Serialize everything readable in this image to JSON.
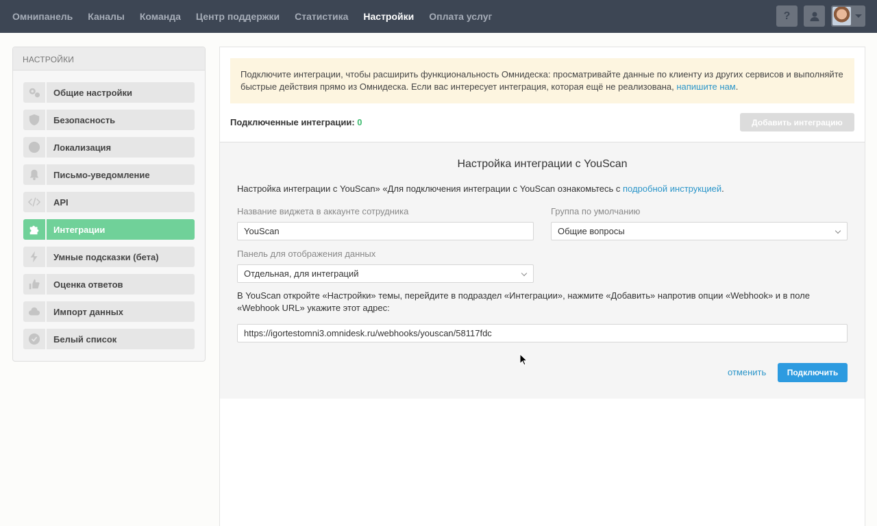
{
  "nav": {
    "items": [
      {
        "label": "Омнипанель"
      },
      {
        "label": "Каналы"
      },
      {
        "label": "Команда"
      },
      {
        "label": "Центр поддержки"
      },
      {
        "label": "Статистика"
      },
      {
        "label": "Настройки",
        "active": true
      },
      {
        "label": "Оплата услуг"
      }
    ],
    "help_label": "?"
  },
  "sidebar": {
    "title": "НАСТРОЙКИ",
    "items": [
      {
        "label": "Общие настройки",
        "icon": "gears-icon"
      },
      {
        "label": "Безопасность",
        "icon": "shield-icon"
      },
      {
        "label": "Локализация",
        "icon": "globe-icon"
      },
      {
        "label": "Письмо-уведомление",
        "icon": "bell-icon"
      },
      {
        "label": "API",
        "icon": "code-icon"
      },
      {
        "label": "Интеграции",
        "icon": "puzzle-icon",
        "active": true
      },
      {
        "label": "Умные подсказки (бета)",
        "icon": "lightning-icon"
      },
      {
        "label": "Оценка ответов",
        "icon": "thumbs-up-icon"
      },
      {
        "label": "Импорт данных",
        "icon": "cloud-upload-icon"
      },
      {
        "label": "Белый список",
        "icon": "check-badge-icon"
      }
    ]
  },
  "notice": {
    "text": "Подключите интеграции, чтобы расширить функциональность Омнидеска: просматривайте данные по клиенту из других сервисов и выполняйте быстрые действия прямо из Омнидеска. Если вас интересует интеграция, которая ещё не реализована, ",
    "link": "напишите нам",
    "tail": "."
  },
  "connected": {
    "label": "Подключенные интеграции:",
    "count": "0"
  },
  "add_button": "Добавить интеграцию",
  "form": {
    "title": "Настройка интеграции с YouScan",
    "desc_text": "Настройка интеграции с YouScan» «Для подключения интеграции с YouScan ознакомьтесь с ",
    "desc_link": "подробной инструкцией",
    "desc_tail": ".",
    "widget_name_label": "Название виджета в аккаунте сотрудника",
    "widget_name_value": "YouScan",
    "group_label": "Группа по умолчанию",
    "group_value": "Общие вопросы",
    "panel_label": "Панель для отображения данных",
    "panel_value": "Отдельная, для интеграций",
    "webhook_text": "В YouScan откройте «Настройки» темы, перейдите в подраздел «Интеграции», нажмите «Добавить» напротив опции «Webhook» и в поле «Webhook URL» укажите этот адрес:",
    "webhook_url": "https://igortestomni3.omnidesk.ru/webhooks/youscan/58117fdc",
    "cancel_label": "отменить",
    "connect_label": "Подключить"
  }
}
